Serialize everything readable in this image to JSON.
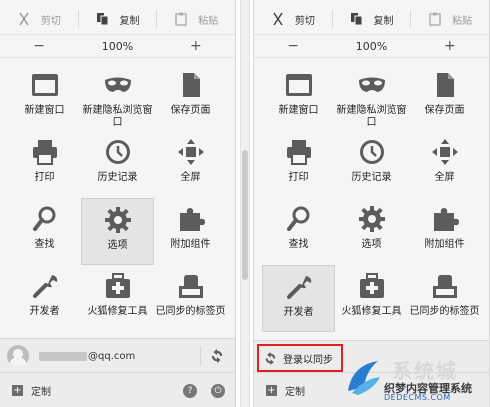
{
  "left_panel": {
    "edit": {
      "cut": "剪切",
      "copy": "复制",
      "paste": "粘贴"
    },
    "zoom": {
      "minus": "−",
      "value": "100%",
      "plus": "+"
    },
    "tiles": [
      {
        "label": "新建窗口",
        "icon": "new-window-icon"
      },
      {
        "label": "新建隐私浏览窗口",
        "icon": "private-mask-icon"
      },
      {
        "label": "保存页面",
        "icon": "save-page-icon"
      },
      {
        "label": "打印",
        "icon": "print-icon"
      },
      {
        "label": "历史记录",
        "icon": "history-clock-icon"
      },
      {
        "label": "全屏",
        "icon": "fullscreen-icon"
      },
      {
        "label": "查找",
        "icon": "find-icon"
      },
      {
        "label": "选项",
        "icon": "options-gear-icon"
      },
      {
        "label": "附加组件",
        "icon": "addons-puzzle-icon"
      },
      {
        "label": "开发者",
        "icon": "developer-wrench-icon"
      },
      {
        "label": "火狐修复工具",
        "icon": "repair-toolbox-icon"
      },
      {
        "label": "已同步的标签页",
        "icon": "synced-tabs-icon"
      }
    ],
    "active_tile": "选项",
    "account_email": "@qq.com",
    "customize": "定制"
  },
  "right_panel": {
    "edit": {
      "cut": "剪切",
      "copy": "复制",
      "paste": "粘贴"
    },
    "zoom": {
      "minus": "−",
      "value": "100%",
      "plus": "+"
    },
    "tiles": [
      {
        "label": "新建窗口",
        "icon": "new-window-icon"
      },
      {
        "label": "新建隐私浏览窗口",
        "icon": "private-mask-icon"
      },
      {
        "label": "保存页面",
        "icon": "save-page-icon"
      },
      {
        "label": "打印",
        "icon": "print-icon"
      },
      {
        "label": "历史记录",
        "icon": "history-clock-icon"
      },
      {
        "label": "全屏",
        "icon": "fullscreen-icon"
      },
      {
        "label": "查找",
        "icon": "find-icon"
      },
      {
        "label": "选项",
        "icon": "options-gear-icon"
      },
      {
        "label": "附加组件",
        "icon": "addons-puzzle-icon"
      },
      {
        "label": "开发者",
        "icon": "developer-wrench-icon"
      },
      {
        "label": "火狐修复工具",
        "icon": "repair-toolbox-icon"
      },
      {
        "label": "已同步的标签页",
        "icon": "synced-tabs-icon"
      }
    ],
    "active_tile": "开发者",
    "signin_label": "登录以同步",
    "customize": "定制"
  },
  "watermark": {
    "title": "系统城",
    "subtitle": "织梦内容管理系统",
    "domain": "DEDECMS.COM"
  },
  "colors": {
    "highlight_border": "#e02020",
    "icon_gray": "#5c5c5c",
    "panel_bg": "#f5f5f5"
  }
}
